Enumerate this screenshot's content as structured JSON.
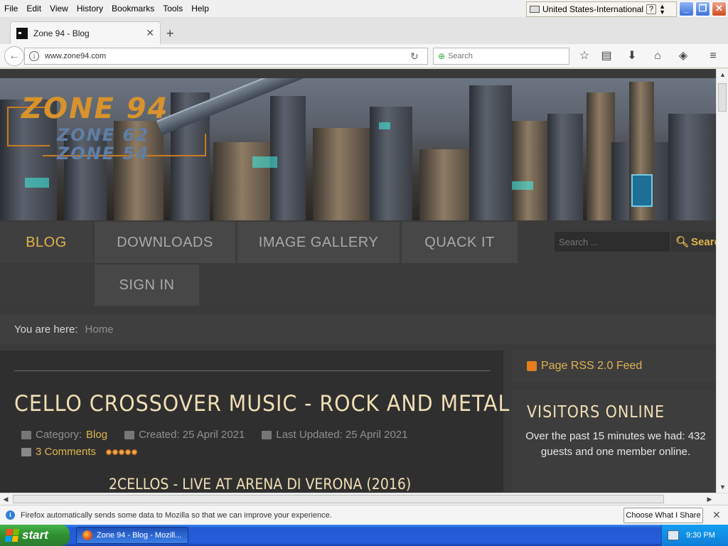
{
  "browser": {
    "menus": [
      "File",
      "Edit",
      "View",
      "History",
      "Bookmarks",
      "Tools",
      "Help"
    ],
    "language_bar": "United States-International",
    "language_help": "?",
    "tab_title": "Zone 94 - Blog",
    "url": "www.zone94.com",
    "search_placeholder": "Search",
    "window_buttons": {
      "minimize": "_",
      "restore": "❐",
      "close": "✕"
    }
  },
  "site": {
    "logo": {
      "primary": "ZONE 94",
      "secondary": "ZONE 62",
      "tertiary": "ZONE 54"
    },
    "nav": [
      "BLOG",
      "DOWNLOADS",
      "IMAGE GALLERY",
      "QUACK IT",
      "SIGN IN"
    ],
    "active_nav": "BLOG",
    "search_placeholder": "Search ...",
    "search_button": "Search",
    "breadcrumb": {
      "label": "You are here:",
      "current": "Home"
    }
  },
  "article": {
    "title": "CELLO CROSSOVER MUSIC - ROCK AND METAL",
    "category_label": "Category:",
    "category": "Blog",
    "created": "Created: 25 April 2021",
    "updated": "Last Updated: 25 April 2021",
    "comments": "3 Comments",
    "rating": 5,
    "subtitle": "2CELLOS - LIVE AT ARENA DI VERONA (2016)"
  },
  "sidebar": {
    "rss": "Page RSS 2.0 Feed",
    "visitors_title": "VISITORS ONLINE",
    "visitors_text": "Over the past 15 minutes we had: 432 guests and one member online."
  },
  "notification": {
    "text": "Firefox automatically sends some data to Mozilla so that we can improve your experience.",
    "button": "Choose What I Share"
  },
  "taskbar": {
    "start": "start",
    "item": "Zone 94 - Blog - Mozill...",
    "clock": "9:30 PM"
  },
  "colors": {
    "accent": "#e0b44e",
    "title": "#f0dfb5",
    "page_bg": "#3a3a3a"
  }
}
